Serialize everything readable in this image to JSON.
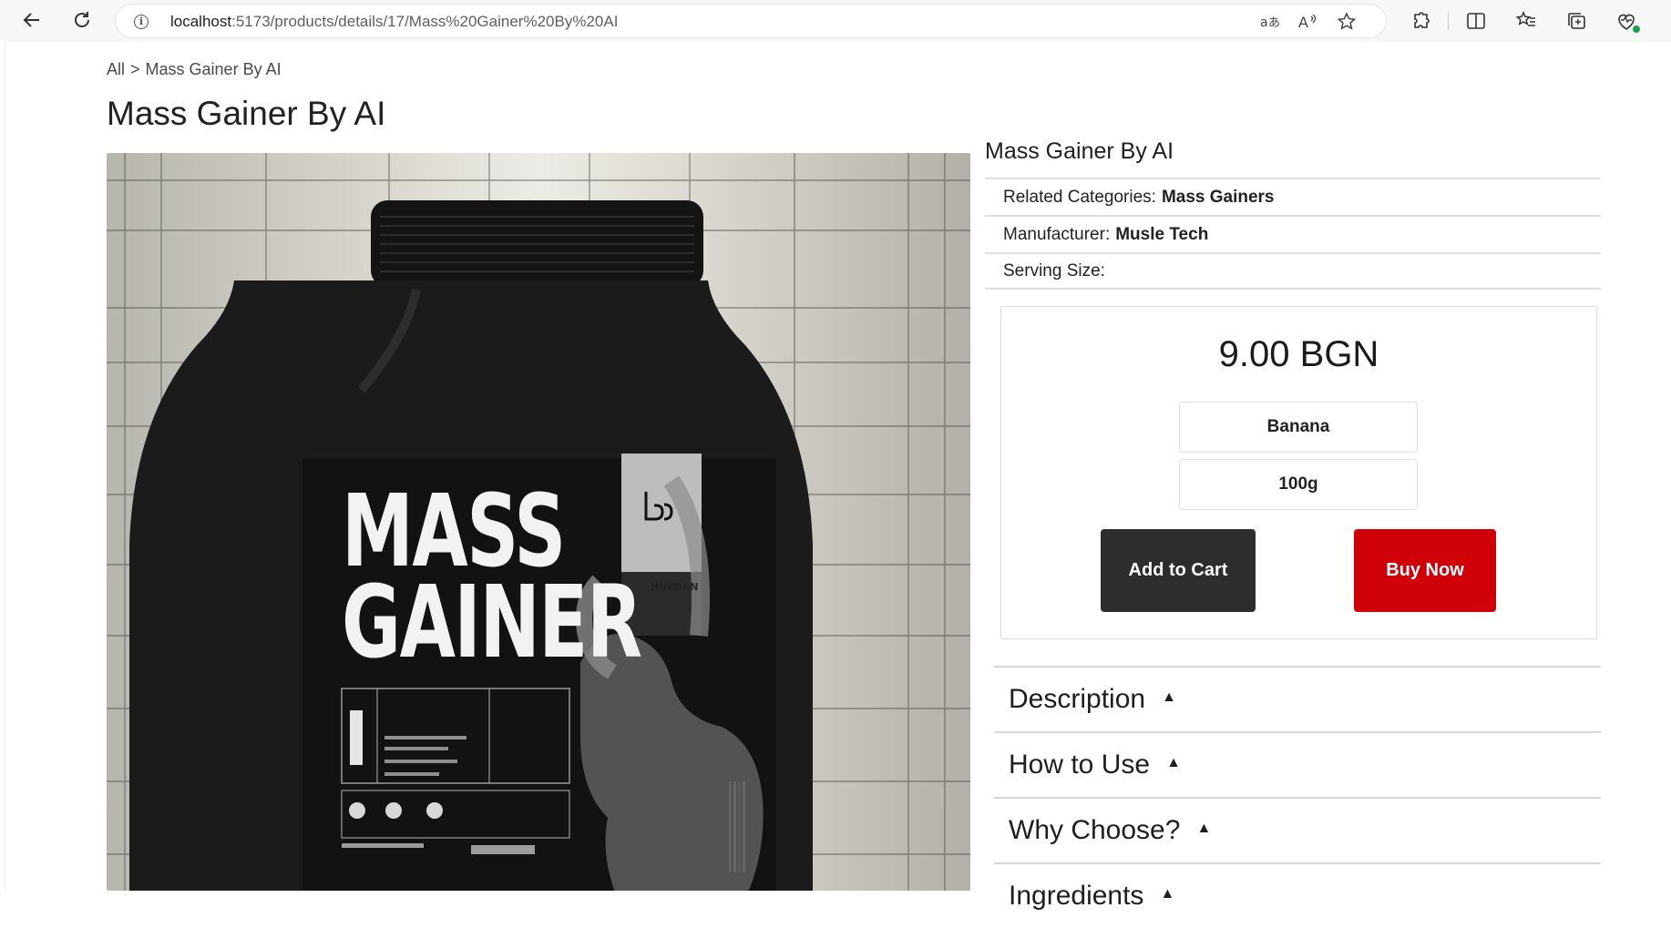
{
  "browser": {
    "url_host": "localhost",
    "url_path": ":5173/products/details/17/Mass%20Gainer%20By%20AI",
    "icons": [
      "back-arrow-icon",
      "reload-icon",
      "info-icon",
      "translate-icon",
      "read-aloud-icon",
      "favorite-star-icon",
      "extensions-icon",
      "split-screen-icon",
      "favorites-icon",
      "collections-icon",
      "browser-essentials-icon"
    ]
  },
  "breadcrumb": {
    "root": "All",
    "separator": ">",
    "current": "Mass Gainer By AI"
  },
  "page_title": "Mass Gainer By AI",
  "product_image": {
    "title_line1": "MASS",
    "title_line2": "GAINER",
    "brand_mark": "HUEDAN"
  },
  "product_info": {
    "title": "Mass Gainer By AI",
    "rows": [
      {
        "label": "Related Categories:",
        "value": "Mass Gainers"
      },
      {
        "label": "Manufacturer:",
        "value": "Musle Tech"
      },
      {
        "label": "Serving Size:",
        "value": ""
      }
    ]
  },
  "purchase": {
    "price": "9.00 BGN",
    "flavor": "Banana",
    "size": "100g",
    "add_to_cart_label": "Add to Cart",
    "buy_now_label": "Buy Now"
  },
  "accordion": [
    {
      "label": "Description",
      "caret": "▲"
    },
    {
      "label": "How to Use",
      "caret": "▲"
    },
    {
      "label": "Why Choose?",
      "caret": "▲"
    },
    {
      "label": "Ingredients",
      "caret": "▲"
    }
  ],
  "colors": {
    "add_to_cart_bg": "#2d2d2d",
    "buy_now_bg": "#cf0008"
  }
}
